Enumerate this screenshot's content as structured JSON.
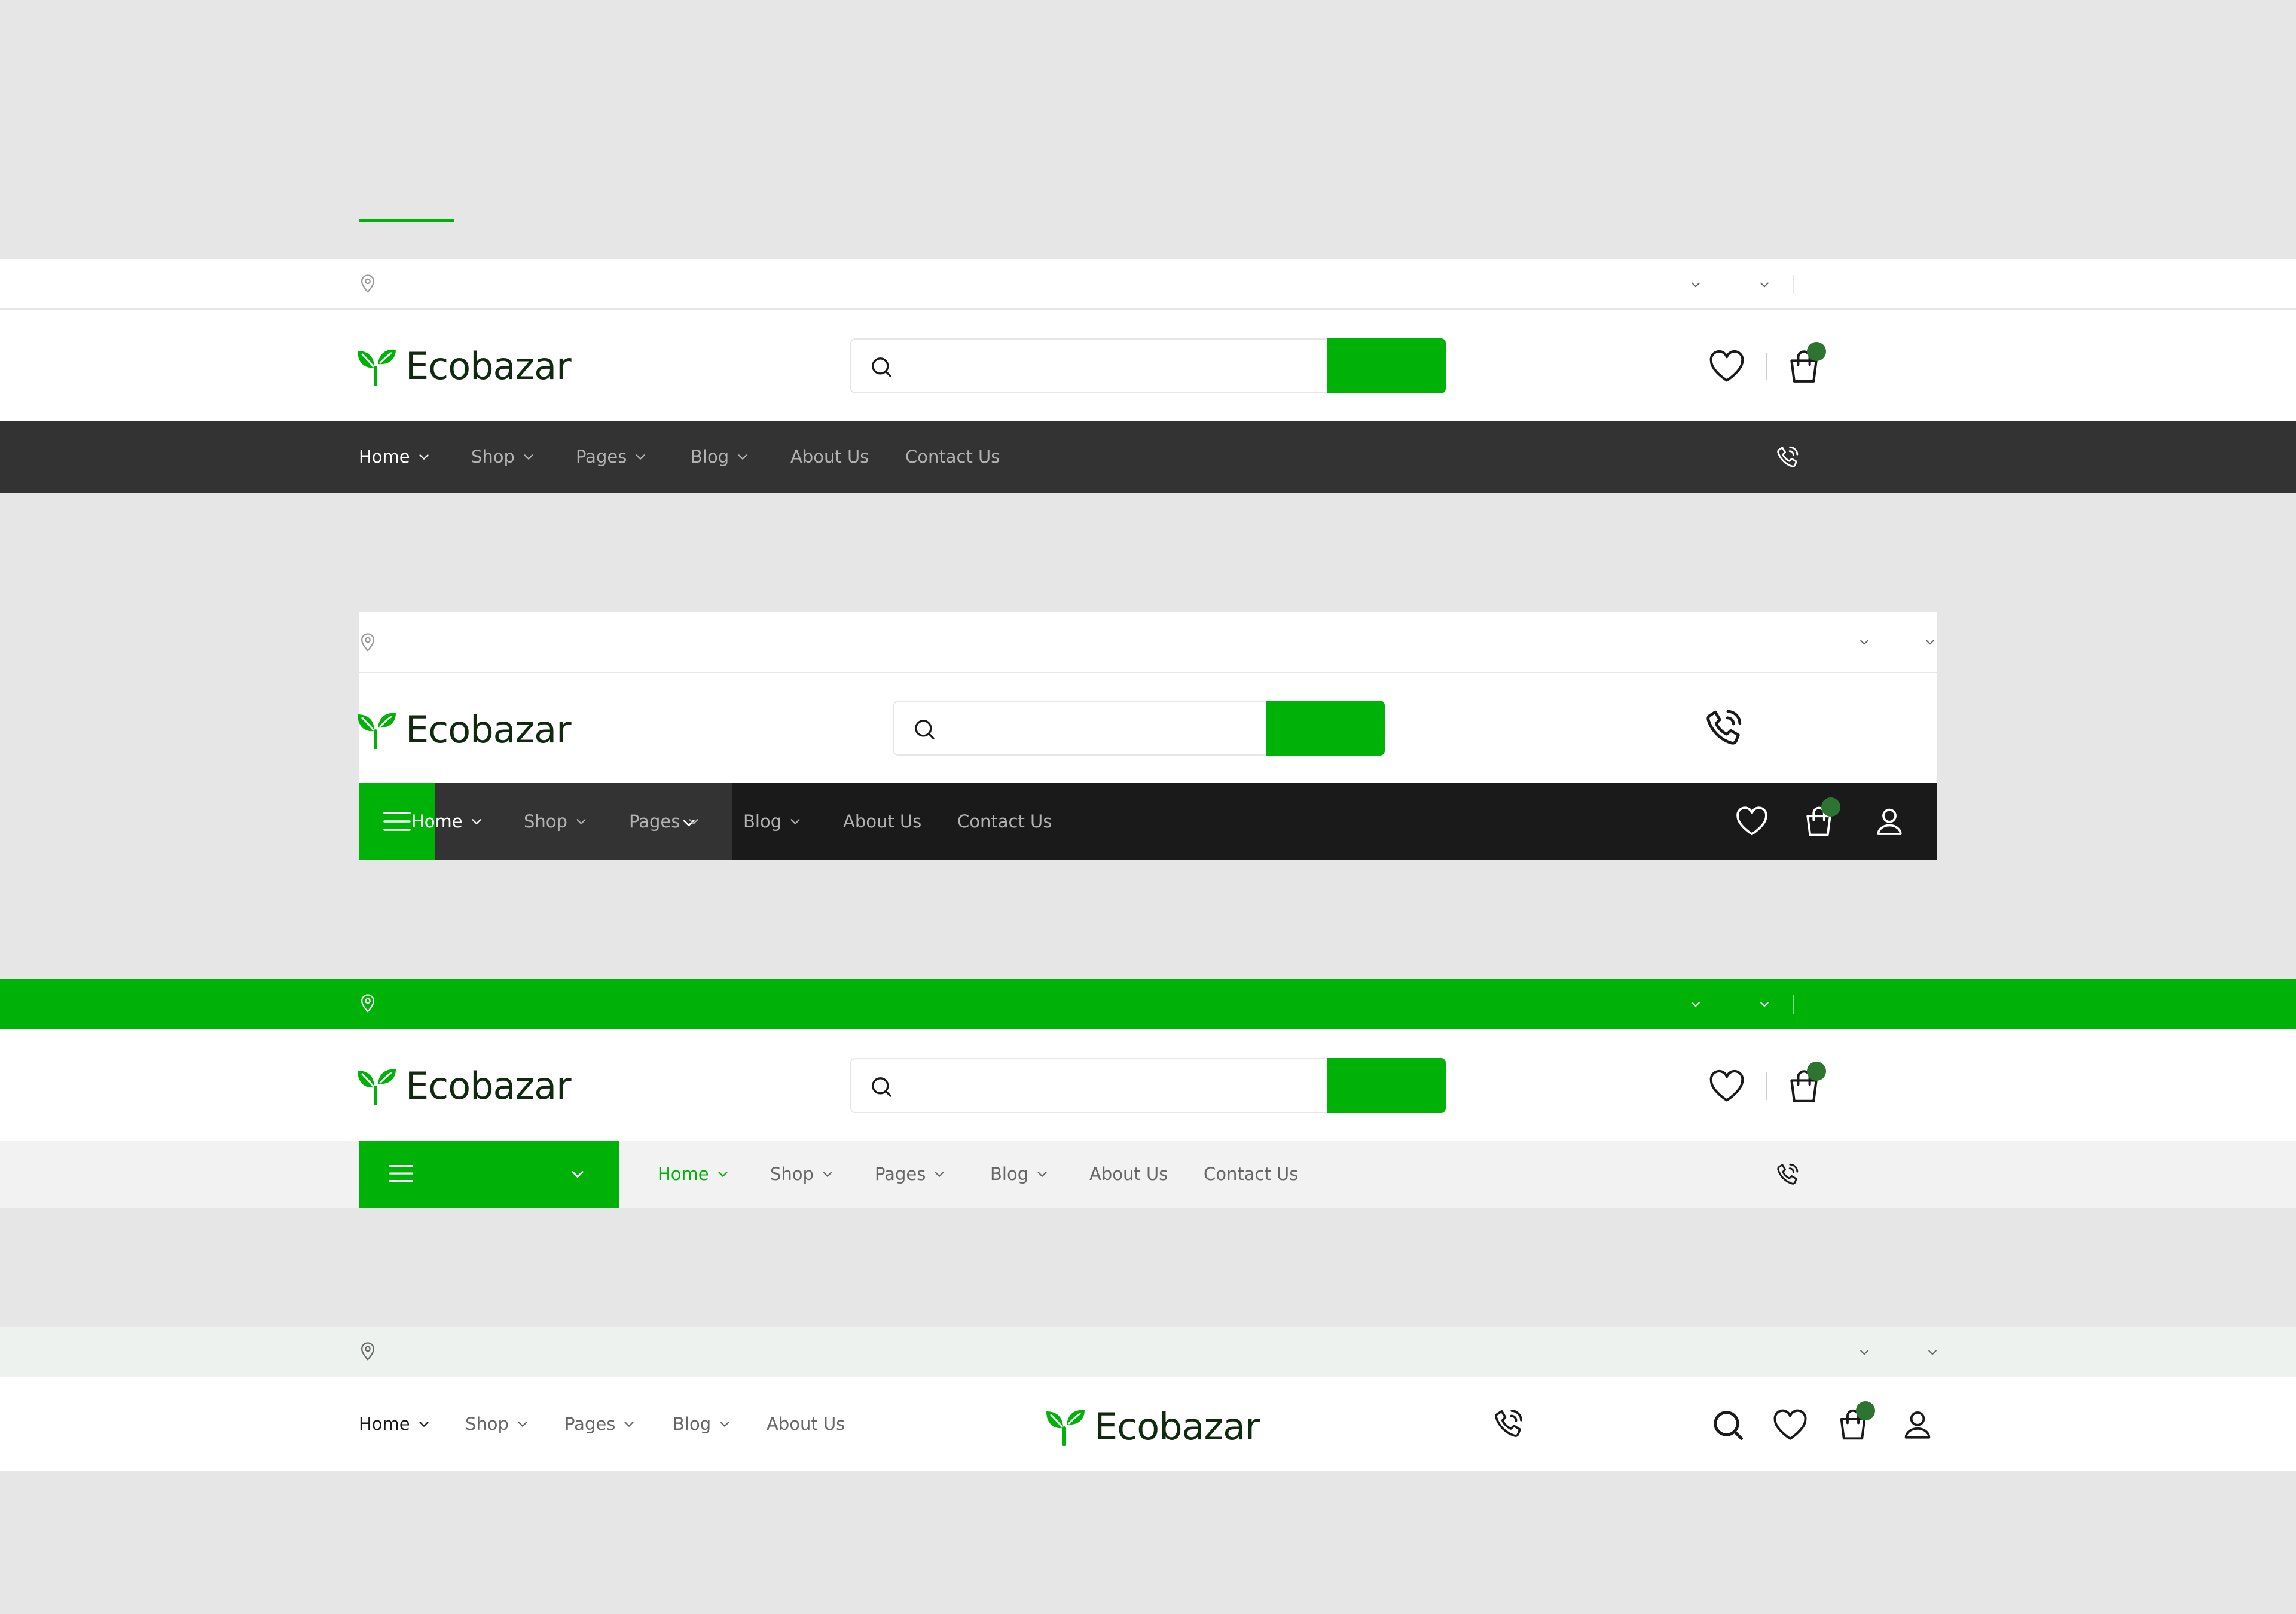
{
  "brand": {
    "name": "Ecobazar"
  },
  "colors": {
    "brand_green": "#00b207",
    "dark_green": "#2c742f",
    "dark_bar": "#333333",
    "darker_bar": "#1a1a1a",
    "light_bar": "#f2f2f2",
    "mint_bar": "#edf2ee",
    "canvas": "#e6e6e6"
  },
  "icons": {
    "location": "map-pin-icon",
    "search": "search-icon",
    "wishlist": "heart-icon",
    "cart": "shopping-bag-icon",
    "phone": "phone-call-icon",
    "user": "user-icon",
    "menu": "hamburger-menu-icon",
    "dropdown": "chevron-down-icon"
  },
  "header1": {
    "nav": [
      {
        "label": "Home",
        "active": true,
        "has_dropdown": true
      },
      {
        "label": "Shop",
        "has_dropdown": true
      },
      {
        "label": "Pages",
        "has_dropdown": true
      },
      {
        "label": "Blog",
        "has_dropdown": true
      },
      {
        "label": "About Us",
        "has_dropdown": false
      },
      {
        "label": "Contact Us",
        "has_dropdown": false
      }
    ]
  },
  "header2": {
    "nav": [
      {
        "label": "Home",
        "active": true,
        "has_dropdown": true
      },
      {
        "label": "Shop",
        "has_dropdown": true
      },
      {
        "label": "Pages",
        "has_dropdown": true
      },
      {
        "label": "Blog",
        "has_dropdown": true
      },
      {
        "label": "About Us",
        "has_dropdown": false
      },
      {
        "label": "Contact Us",
        "has_dropdown": false
      }
    ]
  },
  "header3": {
    "nav": [
      {
        "label": "Home",
        "active": true,
        "has_dropdown": true
      },
      {
        "label": "Shop",
        "has_dropdown": true
      },
      {
        "label": "Pages",
        "has_dropdown": true
      },
      {
        "label": "Blog",
        "has_dropdown": true
      },
      {
        "label": "About Us",
        "has_dropdown": false
      },
      {
        "label": "Contact Us",
        "has_dropdown": false
      }
    ]
  },
  "header4": {
    "nav": [
      {
        "label": "Home",
        "active": true,
        "has_dropdown": true
      },
      {
        "label": "Shop",
        "has_dropdown": true
      },
      {
        "label": "Pages",
        "has_dropdown": true
      },
      {
        "label": "Blog",
        "has_dropdown": true
      },
      {
        "label": "About Us",
        "has_dropdown": false
      }
    ]
  }
}
